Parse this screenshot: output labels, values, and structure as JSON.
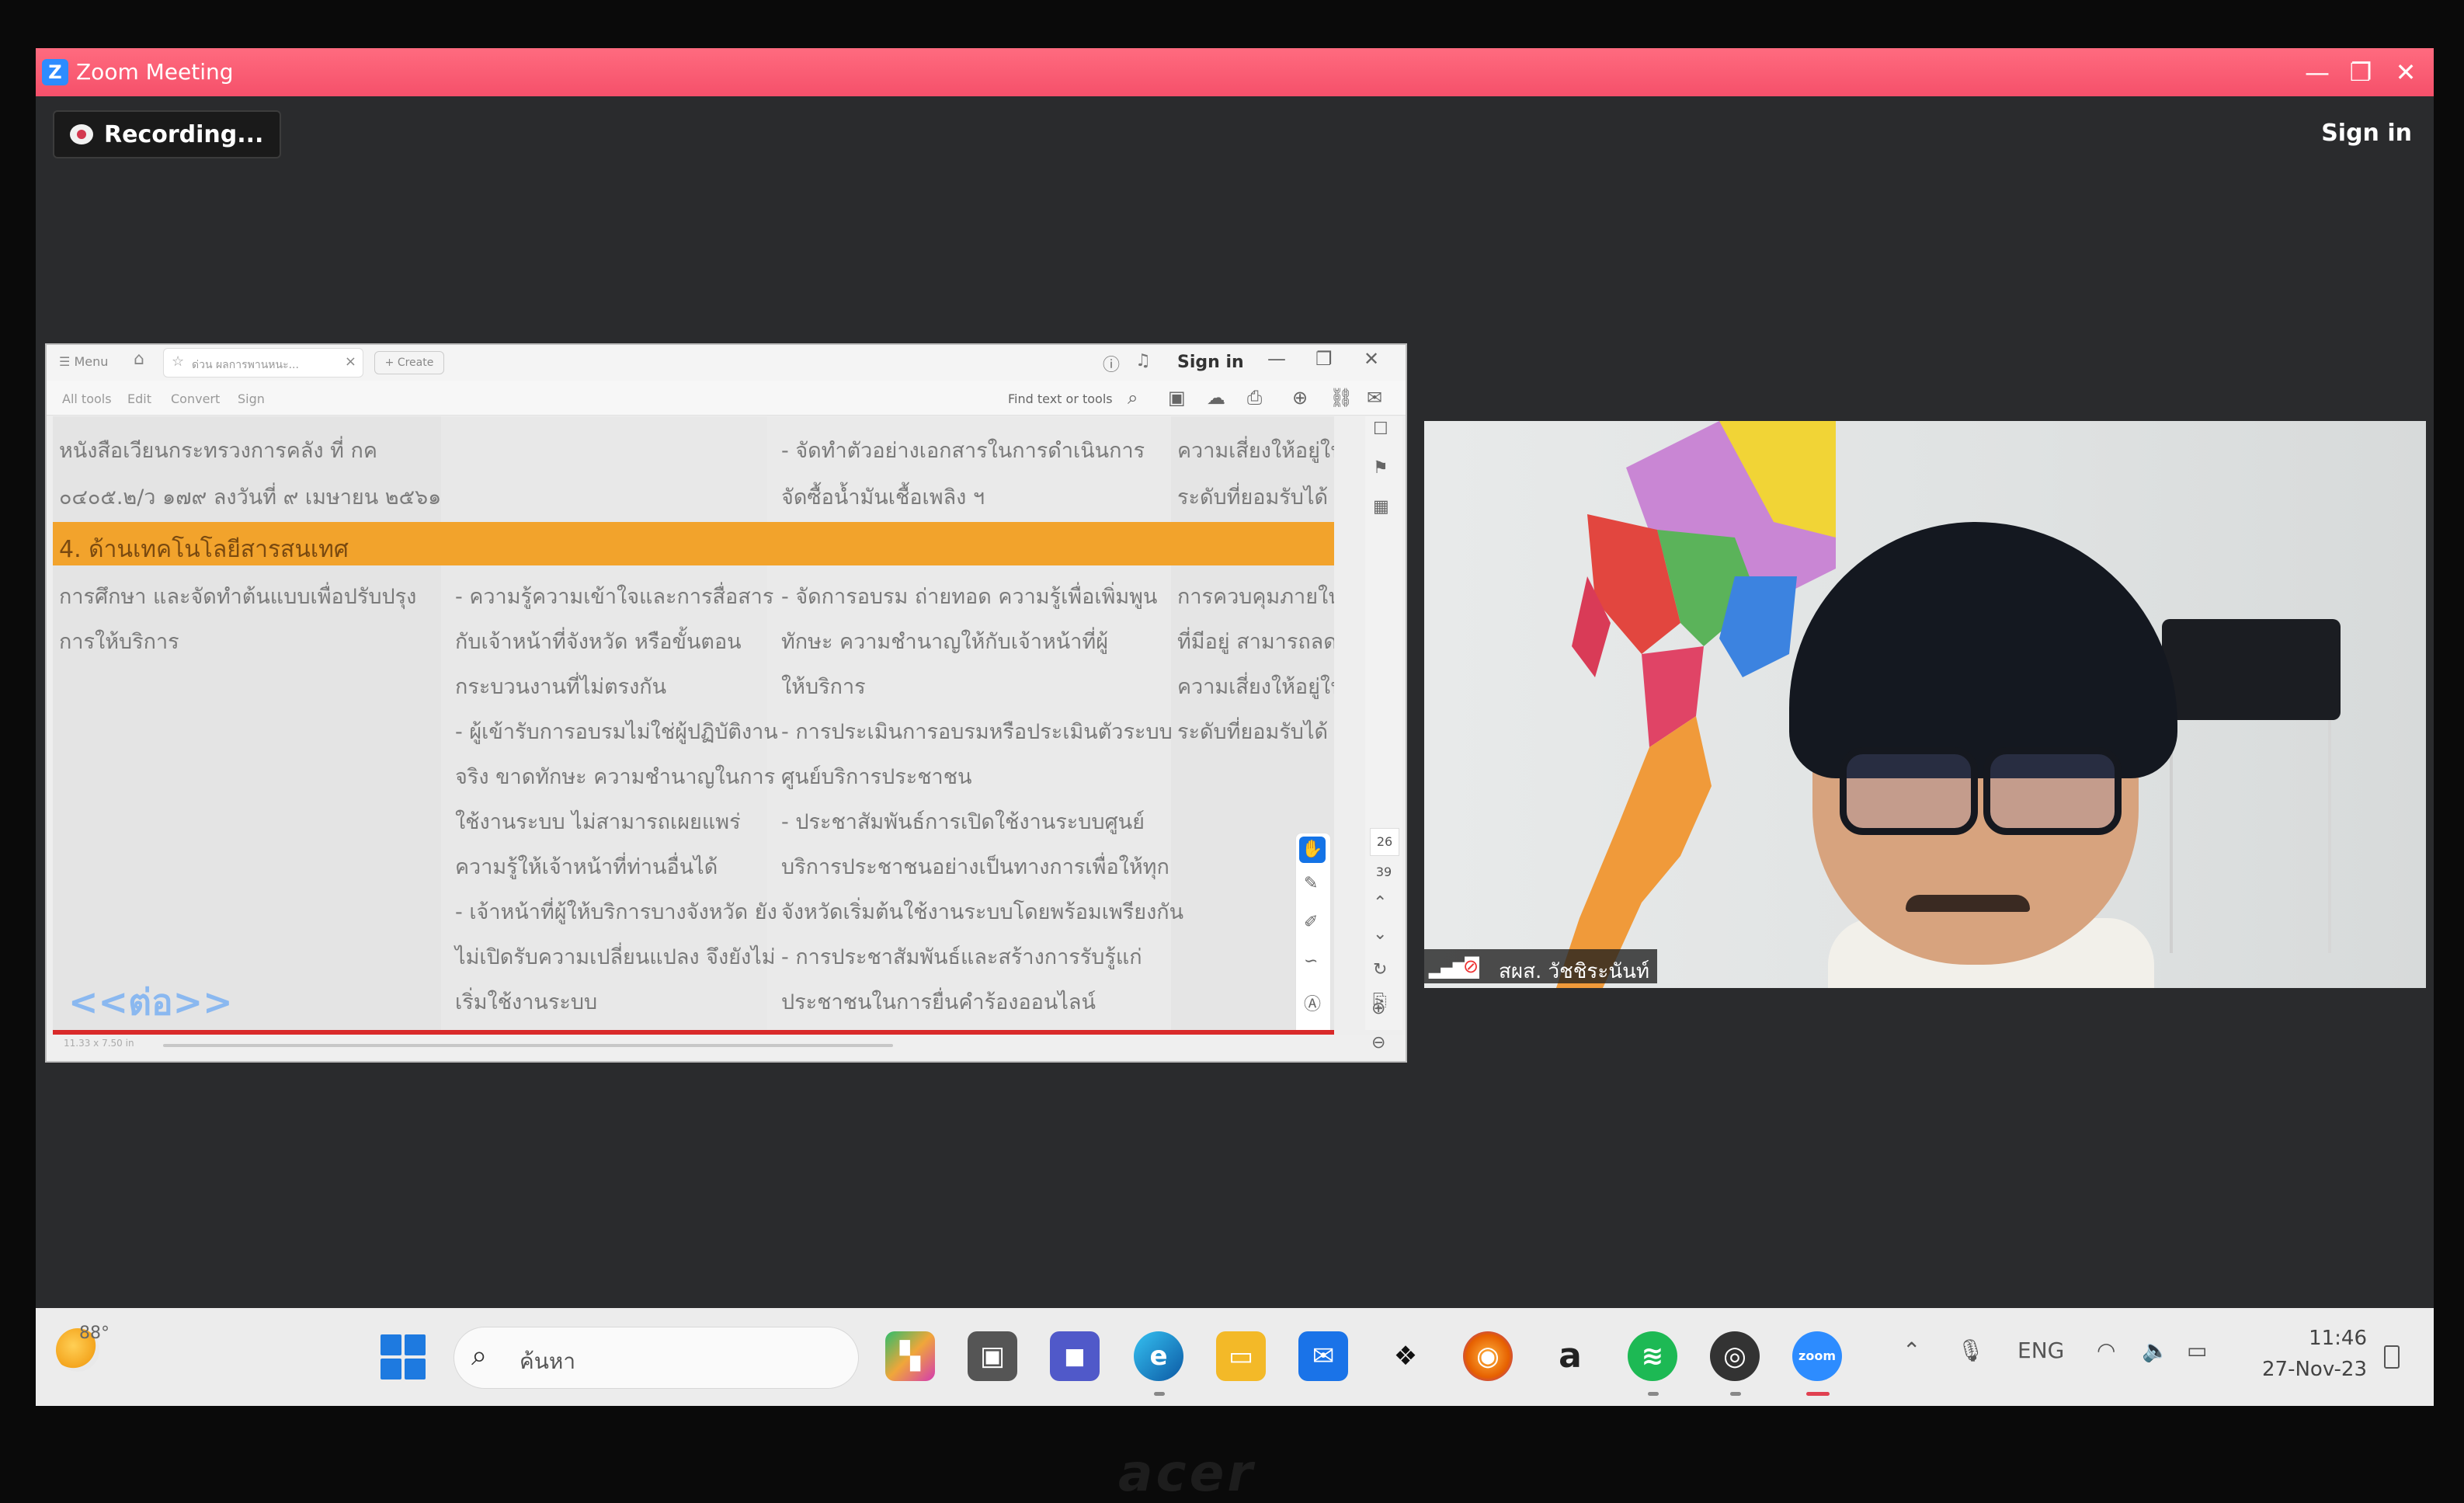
{
  "zoom": {
    "window_title": "Zoom Meeting",
    "recording_label": "Recording...",
    "sign_in": "Sign in",
    "minimize": "—",
    "restore": "❐",
    "close": "✕"
  },
  "acrobat": {
    "menu": "Menu",
    "tab_title": "ด่วน ผลการพานหนะ...",
    "create": "+ Create",
    "sign_in": "Sign in",
    "tools": [
      "All tools",
      "Edit",
      "Convert",
      "Sign"
    ],
    "find_placeholder": "Find text or tools",
    "page_current": "26",
    "page_total": "39",
    "status_size": "11.33 x 7.50 in"
  },
  "document": {
    "row1_col1_line1": "หนังสือเวียนกระทรวงการคลัง ที่ กค",
    "row1_col1_line2": "๐๔๐๕.๒/ว ๑๗๙ ลงวันที่ ๙ เมษายน ๒๕๖๑",
    "row1_col3_line1": "- จัดทำตัวอย่างเอกสารในการดำเนินการ",
    "row1_col3_line2": "จัดซื้อน้ำมันเชื้อเพลิง ฯ",
    "row1_col4_line1": "ความเสี่ยงให้อยู่ใน",
    "row1_col4_line2": "ระดับที่ยอมรับได้",
    "band_label": "4. ด้านเทคโนโลยีสารสนเทศ",
    "col1_lines": [
      "การศึกษา และจัดทำต้นแบบเพื่อปรับปรุง",
      "การให้บริการ"
    ],
    "col2_lines": [
      "- ความรู้ความเข้าใจและการสื่อสาร",
      "กับเจ้าหน้าที่จังหวัด หรือขั้นตอน",
      "กระบวนงานที่ไม่ตรงกัน",
      "- ผู้เข้ารับการอบรมไม่ใช่ผู้ปฏิบัติงาน",
      "จริง ขาดทักษะ ความชำนาญในการ",
      "ใช้งานระบบ ไม่สามารถเผยแพร่",
      "ความรู้ให้เจ้าหน้าที่ท่านอื่นได้",
      "- เจ้าหน้าที่ผู้ให้บริการบางจังหวัด ยัง",
      "ไม่เปิดรับความเปลี่ยนแปลง จึงยังไม่",
      "เริ่มใช้งานระบบ"
    ],
    "col3_lines": [
      "- จัดการอบรม ถ่ายทอด ความรู้เพื่อเพิ่มพูน",
      "ทักษะ ความชำนาญให้กับเจ้าหน้าที่ผู้",
      "ให้บริการ",
      "- การประเมินการอบรมหรือประเมินตัวระบบ",
      "ศูนย์บริการประชาชน",
      "- ประชาสัมพันธ์การเปิดใช้งานระบบศูนย์",
      "บริการประชาชนอย่างเป็นทางการเพื่อให้ทุก",
      "จังหวัดเริ่มต้นใช้งานระบบโดยพร้อมเพรียงกัน",
      "- การประชาสัมพันธ์และสร้างการรับรู้แก่",
      "ประชาชนในการยื่นคำร้องออนไลน์"
    ],
    "col4_lines": [
      "การควบคุมภายใน",
      "ที่มีอยู่ สามารถลด",
      "ความเสี่ยงให้อยู่ใน",
      "ระดับที่ยอมรับได้"
    ],
    "prev_button": "<<ต่อ>>"
  },
  "video": {
    "participant_name": "สผส. วัชชิระนันท์"
  },
  "taskbar": {
    "temperature": "88°",
    "search_placeholder": "ค้นหา",
    "amazon_label": "a",
    "zoom_label": "zoom",
    "language": "ENG",
    "time": "11:46",
    "date": "27-Nov-23"
  },
  "bezel": {
    "brand": "acer"
  },
  "colors": {
    "zoom_title": "#f5506a",
    "band_orange": "#f2a32c",
    "accent_blue": "#1473e6"
  }
}
